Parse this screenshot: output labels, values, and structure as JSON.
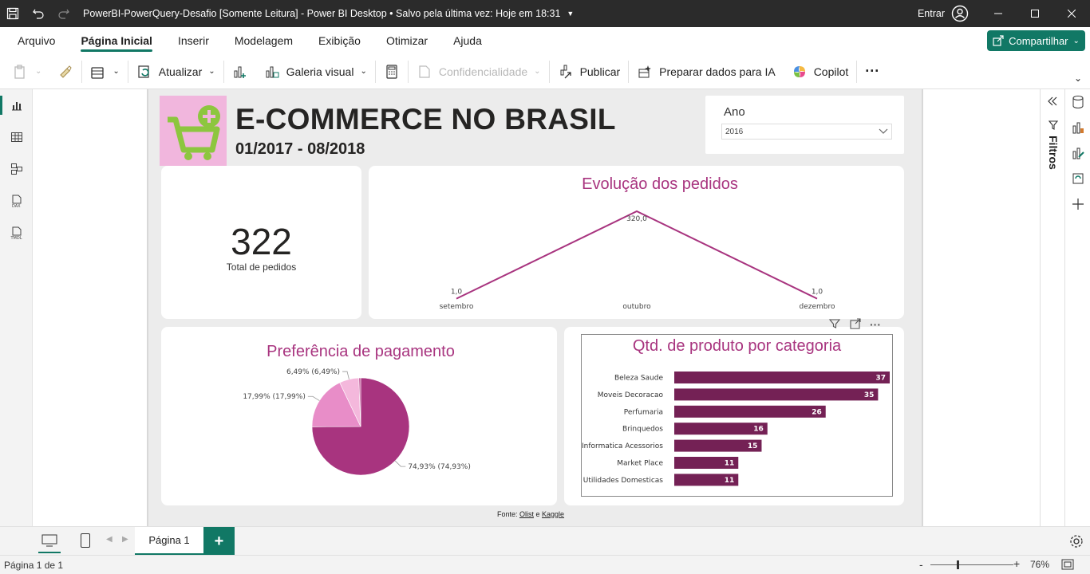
{
  "window": {
    "title": "PowerBI-PowerQuery-Desafio [Somente Leitura] - Power BI Desktop • Salvo pela última vez: Hoje em 18:31",
    "signin_label": "Entrar"
  },
  "menu": {
    "tabs": [
      "Arquivo",
      "Página Inicial",
      "Inserir",
      "Modelagem",
      "Exibição",
      "Otimizar",
      "Ajuda"
    ],
    "active_tab": "Página Inicial",
    "share_label": "Compartilhar"
  },
  "ribbon": {
    "refresh": "Atualizar",
    "visual_gallery": "Galeria visual",
    "sensitivity": "Confidencialidade",
    "publish": "Publicar",
    "prepare_ai": "Preparar dados para IA",
    "copilot": "Copilot"
  },
  "report": {
    "title": "E-COMMERCE NO BRASIL",
    "subtitle": "01/2017 - 08/2018",
    "slicer": {
      "label": "Ano",
      "value": "2016"
    },
    "kpi": {
      "value": "322",
      "label": "Total de pedidos"
    },
    "source": {
      "prefix": "Fonte: ",
      "link1": "Olist",
      "joiner": " e ",
      "link2": "Kaggle"
    }
  },
  "panes": {
    "filters_label": "Filtros"
  },
  "pages": {
    "current": "Página 1"
  },
  "status": {
    "page_info": "Página 1 de 1",
    "zoom": "76%"
  },
  "colors": {
    "accent": "#117865",
    "title_pink": "#a8347f",
    "bar": "#742155",
    "pie_main": "#a8347f",
    "pie_mid": "#e88dc8",
    "pie_light": "#f4b8dc"
  },
  "chart_data": [
    {
      "type": "line",
      "title": "Evolução dos pedidos",
      "categories": [
        "setembro",
        "outubro",
        "dezembro"
      ],
      "series": [
        {
          "values": [
            1.0,
            320.0,
            1.0
          ]
        }
      ],
      "data_labels": [
        "1,0",
        "320,0",
        "1,0"
      ]
    },
    {
      "type": "pie",
      "title": "Preferência de pagamento",
      "values": [
        74.93,
        17.99,
        6.49,
        0.59
      ],
      "labels": [
        "74,93% (74,93%)",
        "17,99% (17,99%)",
        "6,49% (6,49%)",
        ""
      ]
    },
    {
      "type": "bar",
      "orientation": "horizontal",
      "title": "Qtd. de produto por categoria",
      "categories": [
        "Beleza Saude",
        "Moveis Decoracao",
        "Perfumaria",
        "Brinquedos",
        "Informatica Acessorios",
        "Market Place",
        "Utilidades Domesticas"
      ],
      "values": [
        37,
        35,
        26,
        16,
        15,
        11,
        11
      ],
      "xlim": [
        0,
        37
      ]
    }
  ]
}
